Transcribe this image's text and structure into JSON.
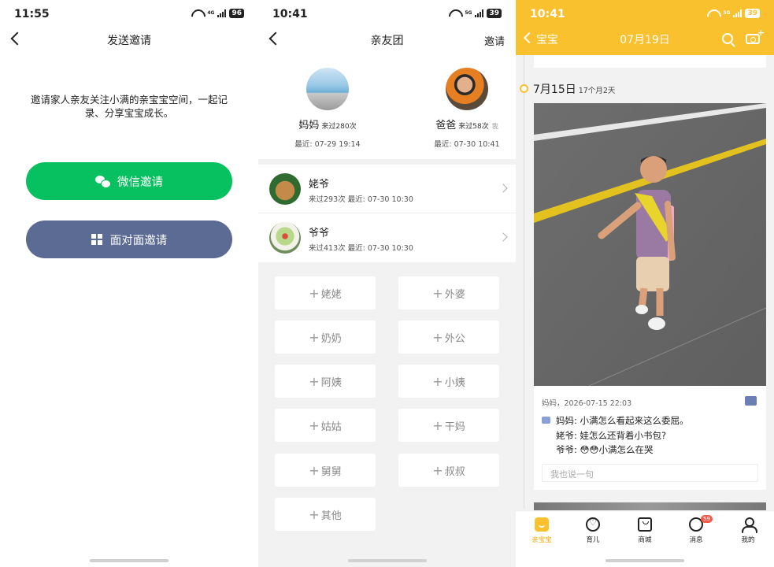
{
  "screen1": {
    "status": {
      "time": "11:55",
      "network": "4G",
      "battery": "96"
    },
    "title": "发送邀请",
    "intro": "邀请家人亲友关注小满的亲宝宝空间，一起记录、分享宝宝成长。",
    "wechat_button": "微信邀请",
    "f2f_button": "面对面邀请",
    "colors": {
      "wechat": "#07c160",
      "f2f": "#5b6b94"
    }
  },
  "screen2": {
    "status": {
      "time": "10:41",
      "network": "5G",
      "battery": "39"
    },
    "title": "亲友团",
    "invite": "邀请",
    "parents": [
      {
        "name": "妈妈",
        "visits": "来过280次",
        "me": "",
        "last": "最近: 07-29 19:14"
      },
      {
        "name": "爸爸",
        "visits": "来过58次",
        "me": "我",
        "last": "最近: 07-30 10:41"
      }
    ],
    "members": [
      {
        "name": "姥爷",
        "info": "来过293次 最近: 07-30 10:30"
      },
      {
        "name": "爷爷",
        "info": "来过413次 最近: 07-30 10:30"
      }
    ],
    "roles": [
      "姥姥",
      "外婆",
      "奶奶",
      "外公",
      "阿姨",
      "小姨",
      "姑姑",
      "干妈",
      "舅舅",
      "叔叔",
      "其他"
    ]
  },
  "screen3": {
    "status": {
      "time": "10:41",
      "network": "5G",
      "battery": "39"
    },
    "baby": "宝宝",
    "date": "07月19日",
    "entry_date": "7月15日",
    "entry_age": "17个月2天",
    "post_meta": "妈妈，2026-07-15 22:03",
    "comments": [
      {
        "author": "妈妈:",
        "text": "小满怎么看起来这么委屈。"
      },
      {
        "author": "姥爷:",
        "text": "娃怎么还背着小书包?"
      },
      {
        "author": "爷爷:",
        "text": "😳😳小满怎么在哭"
      }
    ],
    "reply_placeholder": "我也说一句",
    "tabs": [
      "亲宝宝",
      "育儿",
      "商城",
      "消息",
      "我的"
    ],
    "message_badge": "59",
    "accent": "#f9c12e"
  }
}
